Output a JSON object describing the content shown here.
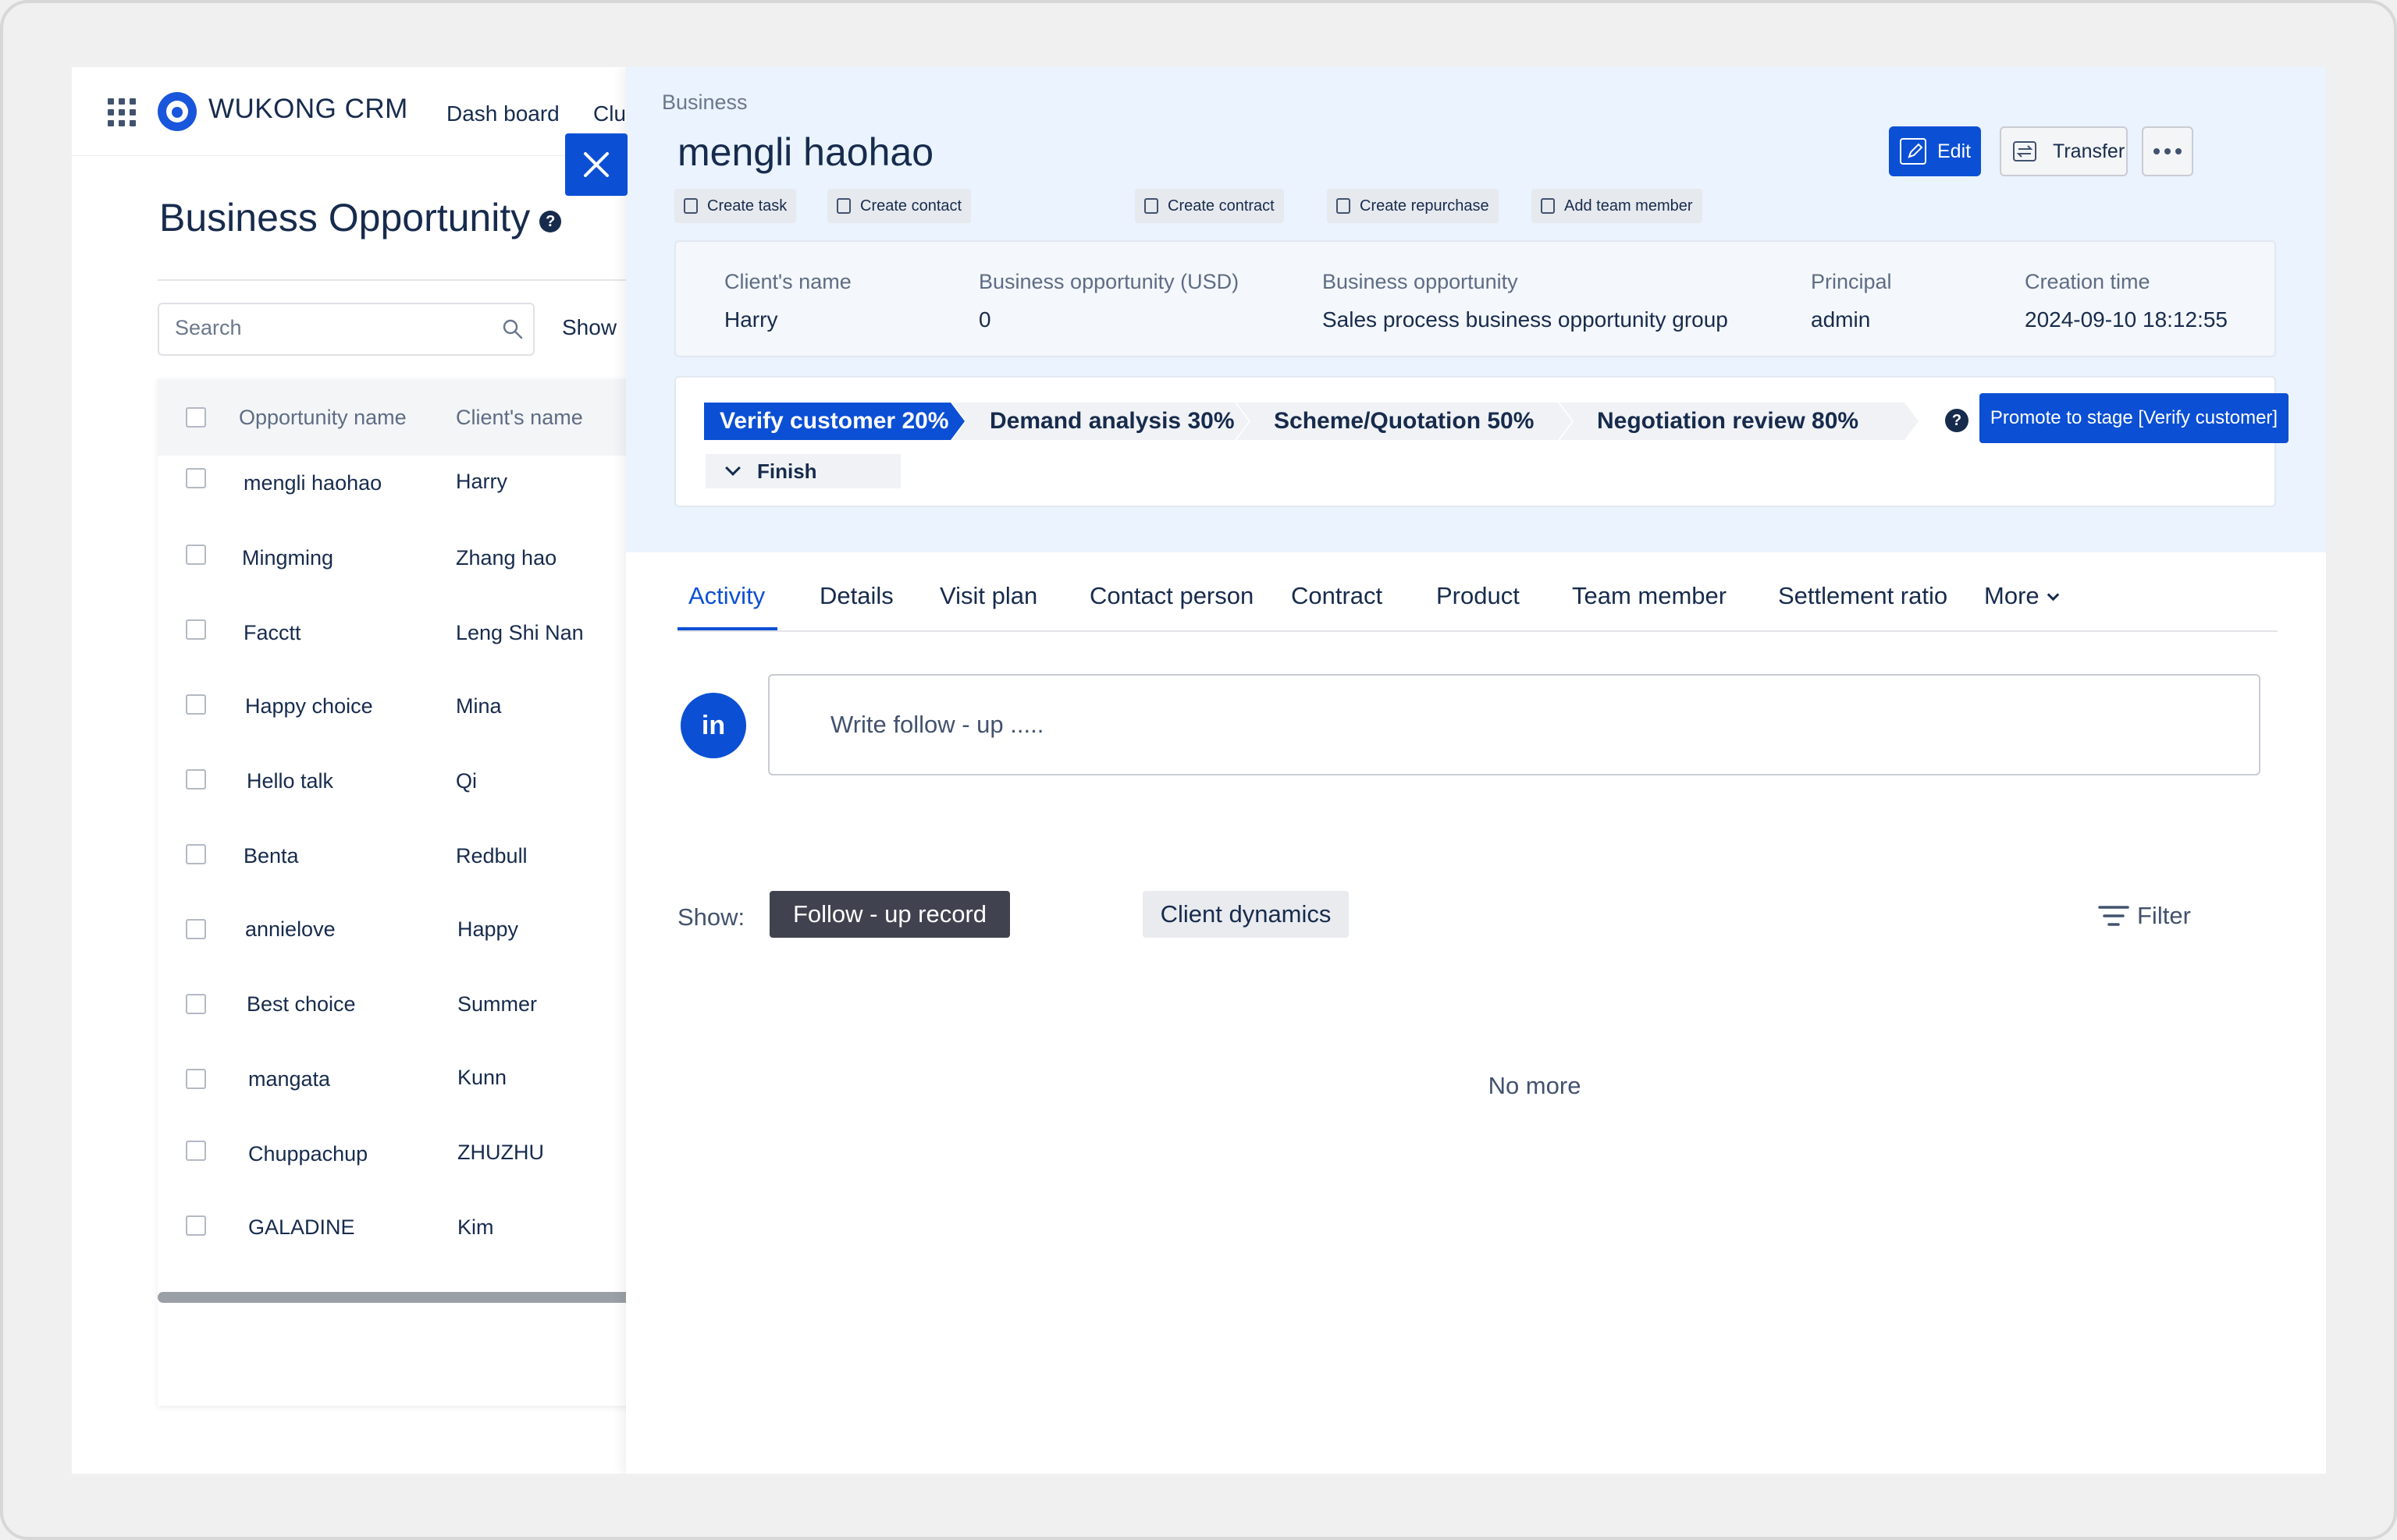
{
  "app": {
    "brand": "WUKONG CRM",
    "nav": [
      "Dash board",
      "Clu"
    ]
  },
  "list_page": {
    "title": "Business Opportunity",
    "help": "?",
    "search_placeholder": "Search",
    "show_label": "Show",
    "columns": [
      "Opportunity name",
      "Client's name"
    ],
    "rows": [
      {
        "name": "mengli haohao",
        "client": "Harry"
      },
      {
        "name": "Mingming",
        "client": "Zhang hao"
      },
      {
        "name": "Facctt",
        "client": "Leng Shi Nan"
      },
      {
        "name": "Happy choice",
        "client": "Mina"
      },
      {
        "name": "Hello talk",
        "client": "Qi"
      },
      {
        "name": "Benta",
        "client": "Redbull"
      },
      {
        "name": "annielove",
        "client": "Happy"
      },
      {
        "name": "Best choice",
        "client": "Summer"
      },
      {
        "name": "mangata",
        "client": "Kunn"
      },
      {
        "name": "Chuppachup",
        "client": "ZHUZHU"
      },
      {
        "name": "GALADINE",
        "client": "Kim"
      }
    ]
  },
  "detail": {
    "breadcrumb": "Business",
    "title": "mengli haohao",
    "buttons": {
      "edit": "Edit",
      "transfer": "Transfer"
    },
    "quick_actions": [
      "Create task",
      "Create contact",
      "Create contract",
      "Create repurchase",
      "Add team member"
    ],
    "info": [
      {
        "label": "Client's name",
        "value": "Harry"
      },
      {
        "label": "Business opportunity (USD)",
        "value": "0"
      },
      {
        "label": "Business opportunity",
        "value": "Sales process business opportunity group"
      },
      {
        "label": "Principal",
        "value": "admin"
      },
      {
        "label": "Creation time",
        "value": "2024-09-10 18:12:55"
      }
    ],
    "stages": [
      "Verify customer 20%",
      "Demand analysis 30%",
      "Scheme/Quotation 50%",
      "Negotiation review 80%"
    ],
    "active_stage_index": 0,
    "finish": "Finish",
    "stage_help": "?",
    "promote_button": "Promote to stage [Verify customer]",
    "tabs": [
      "Activity",
      "Details",
      "Visit plan",
      "Contact person",
      "Contract",
      "Product",
      "Team member",
      "Settlement ratio",
      "More"
    ],
    "active_tab": "Activity",
    "avatar_text": "in",
    "followup_placeholder": "Write follow - up .....",
    "show_label": "Show:",
    "chips": [
      "Follow - up record",
      "Client dynamics"
    ],
    "filter_label": "Filter",
    "empty_text": "No more"
  },
  "colors": {
    "primary": "#0b4fd4",
    "header_bg": "#eaf3fe",
    "text": "#172b4d",
    "chip_dark": "#40424f"
  }
}
